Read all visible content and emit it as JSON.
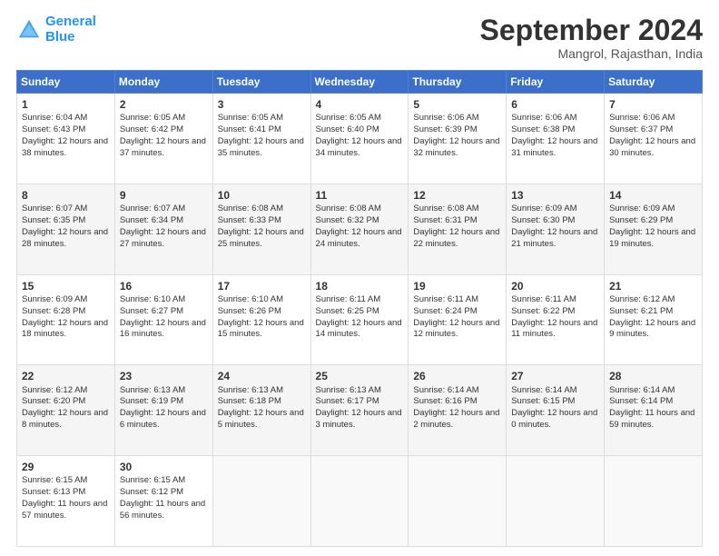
{
  "header": {
    "logo_line1": "General",
    "logo_line2": "Blue",
    "month": "September 2024",
    "location": "Mangrol, Rajasthan, India"
  },
  "days_of_week": [
    "Sunday",
    "Monday",
    "Tuesday",
    "Wednesday",
    "Thursday",
    "Friday",
    "Saturday"
  ],
  "weeks": [
    [
      {
        "day": 1,
        "sunrise": "6:04 AM",
        "sunset": "6:43 PM",
        "daylight": "12 hours and 38 minutes."
      },
      {
        "day": 2,
        "sunrise": "6:05 AM",
        "sunset": "6:42 PM",
        "daylight": "12 hours and 37 minutes."
      },
      {
        "day": 3,
        "sunrise": "6:05 AM",
        "sunset": "6:41 PM",
        "daylight": "12 hours and 35 minutes."
      },
      {
        "day": 4,
        "sunrise": "6:05 AM",
        "sunset": "6:40 PM",
        "daylight": "12 hours and 34 minutes."
      },
      {
        "day": 5,
        "sunrise": "6:06 AM",
        "sunset": "6:39 PM",
        "daylight": "12 hours and 32 minutes."
      },
      {
        "day": 6,
        "sunrise": "6:06 AM",
        "sunset": "6:38 PM",
        "daylight": "12 hours and 31 minutes."
      },
      {
        "day": 7,
        "sunrise": "6:06 AM",
        "sunset": "6:37 PM",
        "daylight": "12 hours and 30 minutes."
      }
    ],
    [
      {
        "day": 8,
        "sunrise": "6:07 AM",
        "sunset": "6:35 PM",
        "daylight": "12 hours and 28 minutes."
      },
      {
        "day": 9,
        "sunrise": "6:07 AM",
        "sunset": "6:34 PM",
        "daylight": "12 hours and 27 minutes."
      },
      {
        "day": 10,
        "sunrise": "6:08 AM",
        "sunset": "6:33 PM",
        "daylight": "12 hours and 25 minutes."
      },
      {
        "day": 11,
        "sunrise": "6:08 AM",
        "sunset": "6:32 PM",
        "daylight": "12 hours and 24 minutes."
      },
      {
        "day": 12,
        "sunrise": "6:08 AM",
        "sunset": "6:31 PM",
        "daylight": "12 hours and 22 minutes."
      },
      {
        "day": 13,
        "sunrise": "6:09 AM",
        "sunset": "6:30 PM",
        "daylight": "12 hours and 21 minutes."
      },
      {
        "day": 14,
        "sunrise": "6:09 AM",
        "sunset": "6:29 PM",
        "daylight": "12 hours and 19 minutes."
      }
    ],
    [
      {
        "day": 15,
        "sunrise": "6:09 AM",
        "sunset": "6:28 PM",
        "daylight": "12 hours and 18 minutes."
      },
      {
        "day": 16,
        "sunrise": "6:10 AM",
        "sunset": "6:27 PM",
        "daylight": "12 hours and 16 minutes."
      },
      {
        "day": 17,
        "sunrise": "6:10 AM",
        "sunset": "6:26 PM",
        "daylight": "12 hours and 15 minutes."
      },
      {
        "day": 18,
        "sunrise": "6:11 AM",
        "sunset": "6:25 PM",
        "daylight": "12 hours and 14 minutes."
      },
      {
        "day": 19,
        "sunrise": "6:11 AM",
        "sunset": "6:24 PM",
        "daylight": "12 hours and 12 minutes."
      },
      {
        "day": 20,
        "sunrise": "6:11 AM",
        "sunset": "6:22 PM",
        "daylight": "12 hours and 11 minutes."
      },
      {
        "day": 21,
        "sunrise": "6:12 AM",
        "sunset": "6:21 PM",
        "daylight": "12 hours and 9 minutes."
      }
    ],
    [
      {
        "day": 22,
        "sunrise": "6:12 AM",
        "sunset": "6:20 PM",
        "daylight": "12 hours and 8 minutes."
      },
      {
        "day": 23,
        "sunrise": "6:13 AM",
        "sunset": "6:19 PM",
        "daylight": "12 hours and 6 minutes."
      },
      {
        "day": 24,
        "sunrise": "6:13 AM",
        "sunset": "6:18 PM",
        "daylight": "12 hours and 5 minutes."
      },
      {
        "day": 25,
        "sunrise": "6:13 AM",
        "sunset": "6:17 PM",
        "daylight": "12 hours and 3 minutes."
      },
      {
        "day": 26,
        "sunrise": "6:14 AM",
        "sunset": "6:16 PM",
        "daylight": "12 hours and 2 minutes."
      },
      {
        "day": 27,
        "sunrise": "6:14 AM",
        "sunset": "6:15 PM",
        "daylight": "12 hours and 0 minutes."
      },
      {
        "day": 28,
        "sunrise": "6:14 AM",
        "sunset": "6:14 PM",
        "daylight": "11 hours and 59 minutes."
      }
    ],
    [
      {
        "day": 29,
        "sunrise": "6:15 AM",
        "sunset": "6:13 PM",
        "daylight": "11 hours and 57 minutes."
      },
      {
        "day": 30,
        "sunrise": "6:15 AM",
        "sunset": "6:12 PM",
        "daylight": "11 hours and 56 minutes."
      },
      null,
      null,
      null,
      null,
      null
    ]
  ]
}
